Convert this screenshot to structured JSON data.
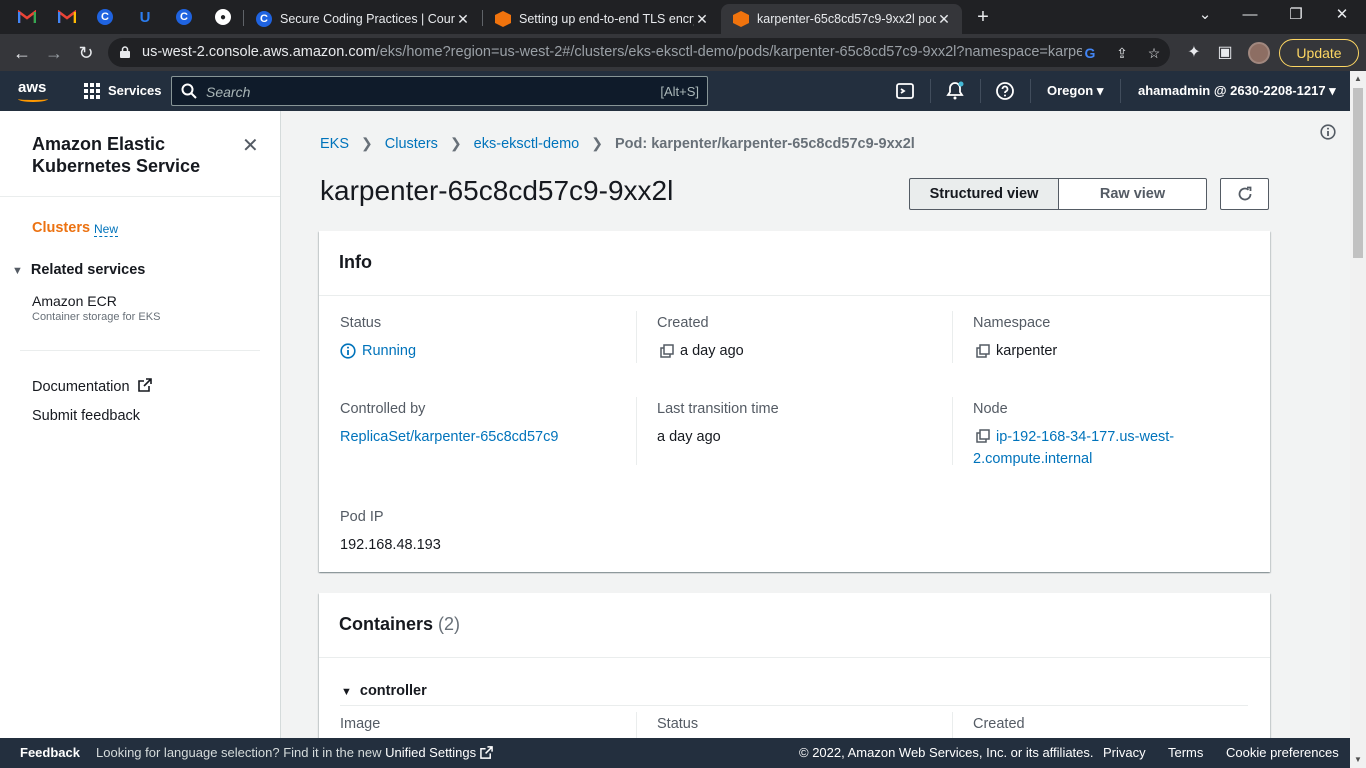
{
  "browser": {
    "tabs": [
      {
        "title": "Secure Coding Practices | Course",
        "active": false
      },
      {
        "title": "Setting up end-to-end TLS encry",
        "active": false
      },
      {
        "title": "karpenter-65c8cd57c9-9xx2l pod",
        "active": true
      }
    ],
    "url_host": "us-west-2.console.aws.amazon.com",
    "url_path": "/eks/home?region=us-west-2#/clusters/eks-eksctl-demo/pods/karpenter-65c8cd57c9-9xx2l?namespace=karpen...",
    "update_label": "Update"
  },
  "aws_header": {
    "logo": "aws",
    "services_label": "Services",
    "search_placeholder": "Search",
    "search_shortcut": "[Alt+S]",
    "region": "Oregon",
    "account": "ahamadmin @ 2630-2208-1217"
  },
  "sidebar": {
    "title": "Amazon Elastic Kubernetes Service",
    "clusters": "Clusters",
    "new_badge": "New",
    "related_services": "Related services",
    "ecr": "Amazon ECR",
    "ecr_sub": "Container storage for EKS",
    "documentation": "Documentation",
    "submit_feedback": "Submit feedback"
  },
  "breadcrumb": [
    "EKS",
    "Clusters",
    "eks-eksctl-demo",
    "Pod: karpenter/karpenter-65c8cd57c9-9xx2l"
  ],
  "page": {
    "title": "karpenter-65c8cd57c9-9xx2l",
    "structured_view": "Structured view",
    "raw_view": "Raw view"
  },
  "info": {
    "heading": "Info",
    "status_label": "Status",
    "status_value": "Running",
    "created_label": "Created",
    "created_value": "a day ago",
    "namespace_label": "Namespace",
    "namespace_value": "karpenter",
    "controlled_by_label": "Controlled by",
    "controlled_by_value": "ReplicaSet/karpenter-65c8cd57c9",
    "last_transition_label": "Last transition time",
    "last_transition_value": "a day ago",
    "node_label": "Node",
    "node_value_1": "ip-192-168-34-177.us-west-",
    "node_value_2": "2.compute.internal",
    "pod_ip_label": "Pod IP",
    "pod_ip_value": "192.168.48.193"
  },
  "containers": {
    "heading": "Containers",
    "count": "(2)",
    "group": "controller",
    "image_label": "Image",
    "status_label": "Status",
    "created_label": "Created"
  },
  "footer": {
    "feedback": "Feedback",
    "hint": "Looking for language selection? Find it in the new",
    "unified_settings": "Unified Settings",
    "copyright": "© 2022, Amazon Web Services, Inc. or its affiliates.",
    "privacy": "Privacy",
    "terms": "Terms",
    "cookies": "Cookie preferences"
  },
  "colors": {
    "aws_dark": "#232f3e",
    "link": "#0073bb",
    "accent_orange": "#ec7211"
  }
}
